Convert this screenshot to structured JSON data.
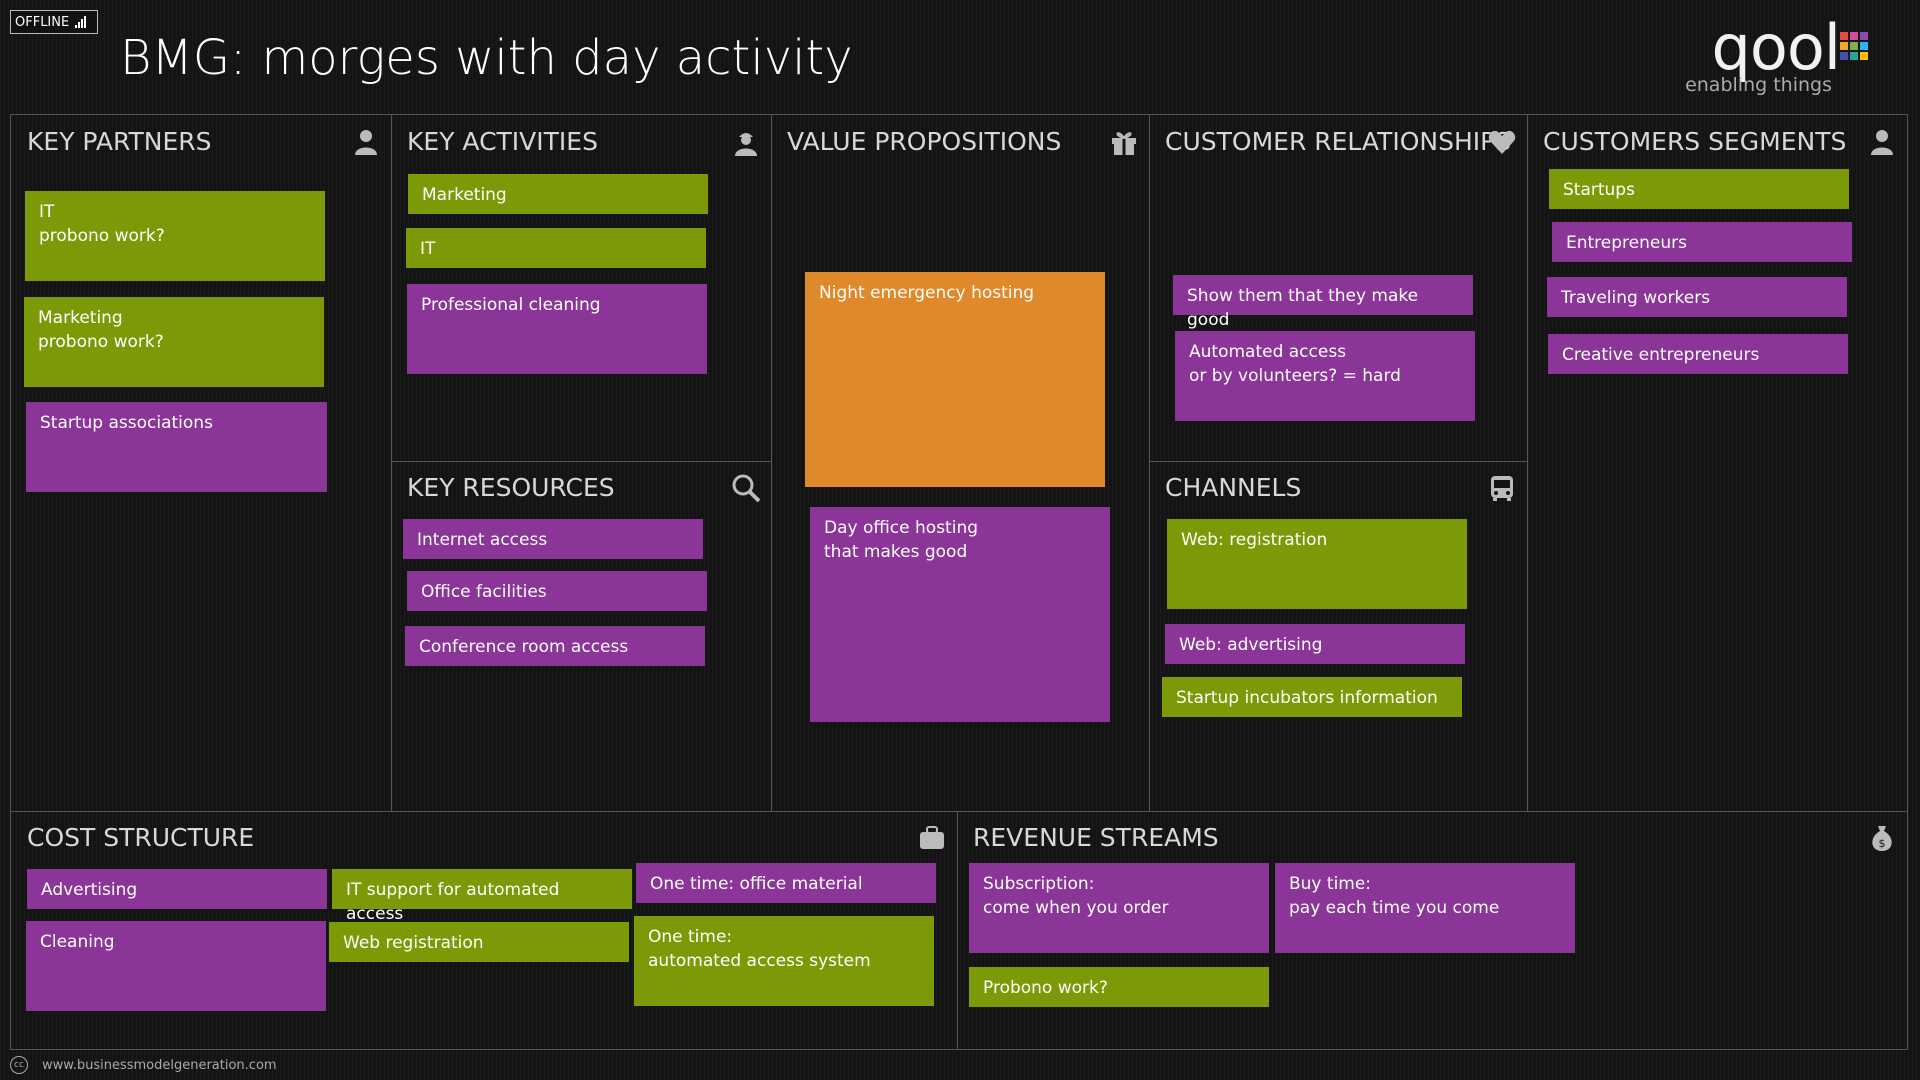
{
  "status": {
    "offline_label": "OFFLINE"
  },
  "title": "BMG: morges with day activity",
  "logo": {
    "word": "qool",
    "tagline": "enabling things",
    "colors": [
      "#e94b3c",
      "#d44a9c",
      "#8b4ab3",
      "#f5a623",
      "#7cb342",
      "#29b6f6",
      "#3f51b5",
      "#26a69a",
      "#ffc107"
    ]
  },
  "colors": {
    "green": "#7c9a07",
    "purple": "#8a3597",
    "orange": "#e0892a"
  },
  "panels": {
    "key_partners": {
      "title": "KEY PARTNERS",
      "icon": "person-icon",
      "notes": [
        {
          "text": "IT\nprobono work?",
          "color": "green"
        },
        {
          "text": "Marketing\nprobono work?",
          "color": "green"
        },
        {
          "text": "Startup associations",
          "color": "purple"
        }
      ]
    },
    "key_activities": {
      "title": "KEY ACTIVITIES",
      "icon": "worker-icon",
      "notes": [
        {
          "text": "Marketing",
          "color": "green"
        },
        {
          "text": "IT",
          "color": "green"
        },
        {
          "text": "Professional cleaning",
          "color": "purple"
        }
      ]
    },
    "key_resources": {
      "title": "KEY RESOURCES",
      "icon": "magnifier-icon",
      "notes": [
        {
          "text": "Internet access",
          "color": "purple"
        },
        {
          "text": "Office facilities",
          "color": "purple"
        },
        {
          "text": "Conference room access",
          "color": "purple"
        }
      ]
    },
    "value_propositions": {
      "title": "VALUE PROPOSITIONS",
      "icon": "gift-icon",
      "notes": [
        {
          "text": "Night emergency hosting",
          "color": "orange"
        },
        {
          "text": "Day office hosting\nthat makes good",
          "color": "purple"
        }
      ]
    },
    "customer_relationships": {
      "title": "CUSTOMER RELATIONSHIPS",
      "icon": "heart-icon",
      "notes": [
        {
          "text": "Show them that they make good",
          "color": "purple"
        },
        {
          "text": "Automated access\nor by volunteers? = hard",
          "color": "purple"
        }
      ]
    },
    "channels": {
      "title": "CHANNELS",
      "icon": "bus-icon",
      "notes": [
        {
          "text": "Web: registration",
          "color": "green"
        },
        {
          "text": "Web: advertising",
          "color": "purple"
        },
        {
          "text": "Startup incubators information",
          "color": "green"
        }
      ]
    },
    "customer_segments": {
      "title": "CUSTOMERS SEGMENTS",
      "icon": "person-icon",
      "notes": [
        {
          "text": "Startups",
          "color": "green"
        },
        {
          "text": "Entrepreneurs",
          "color": "purple"
        },
        {
          "text": "Traveling workers",
          "color": "purple"
        },
        {
          "text": "Creative entrepreneurs",
          "color": "purple"
        }
      ]
    },
    "cost_structure": {
      "title": "COST STRUCTURE",
      "icon": "briefcase-icon",
      "notes": [
        {
          "text": "Advertising",
          "color": "purple"
        },
        {
          "text": "Cleaning",
          "color": "purple"
        },
        {
          "text": "IT support for automated access",
          "color": "green"
        },
        {
          "text": "Web registration",
          "color": "green"
        },
        {
          "text": "One time: office material",
          "color": "purple"
        },
        {
          "text": "One time:\nautomated access system",
          "color": "green"
        }
      ]
    },
    "revenue_streams": {
      "title": "REVENUE STREAMS",
      "icon": "money-bag-icon",
      "notes": [
        {
          "text": "Subscription:\ncome when you order",
          "color": "purple"
        },
        {
          "text": "Buy time:\npay each time you come",
          "color": "purple"
        },
        {
          "text": "Probono work?",
          "color": "green"
        }
      ]
    }
  },
  "footer": {
    "cc": "cc",
    "url": "www.businessmodelgeneration.com"
  }
}
